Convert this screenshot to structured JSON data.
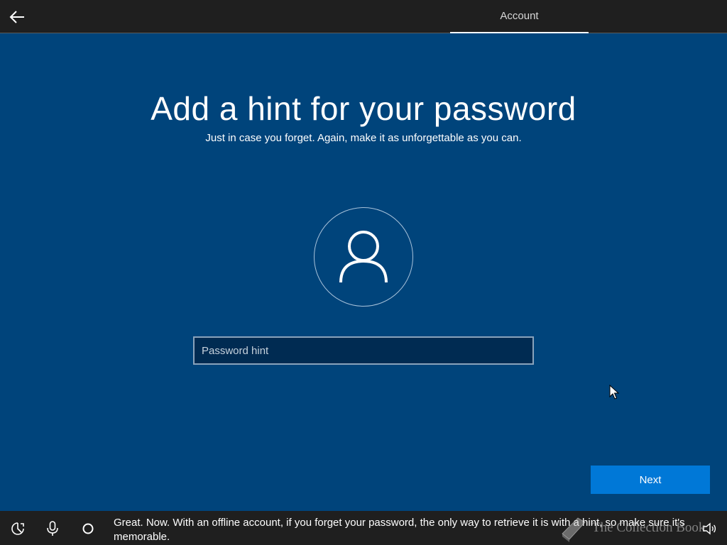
{
  "header": {
    "back_icon": "arrow-left-icon",
    "tab_label": "Account"
  },
  "main": {
    "title": "Add a hint for your password",
    "subtitle": "Just in case you forget. Again, make it as unforgettable as you can.",
    "avatar_icon": "user-icon",
    "hint_placeholder": "Password hint",
    "hint_value": "",
    "next_label": "Next"
  },
  "bottom": {
    "icons": [
      "accessibility-icon",
      "microphone-icon",
      "cortana-icon",
      "volume-icon"
    ],
    "cortana_message": "Great. Now. With an offline account, if you forget your password, the only way to retrieve it is with a hint, so make sure it's memorable.",
    "watermark": "The Collection Book"
  },
  "colors": {
    "background": "#00447b",
    "bar": "#1f1f1f",
    "accent": "#0078d7",
    "input_bg": "#002b52"
  }
}
